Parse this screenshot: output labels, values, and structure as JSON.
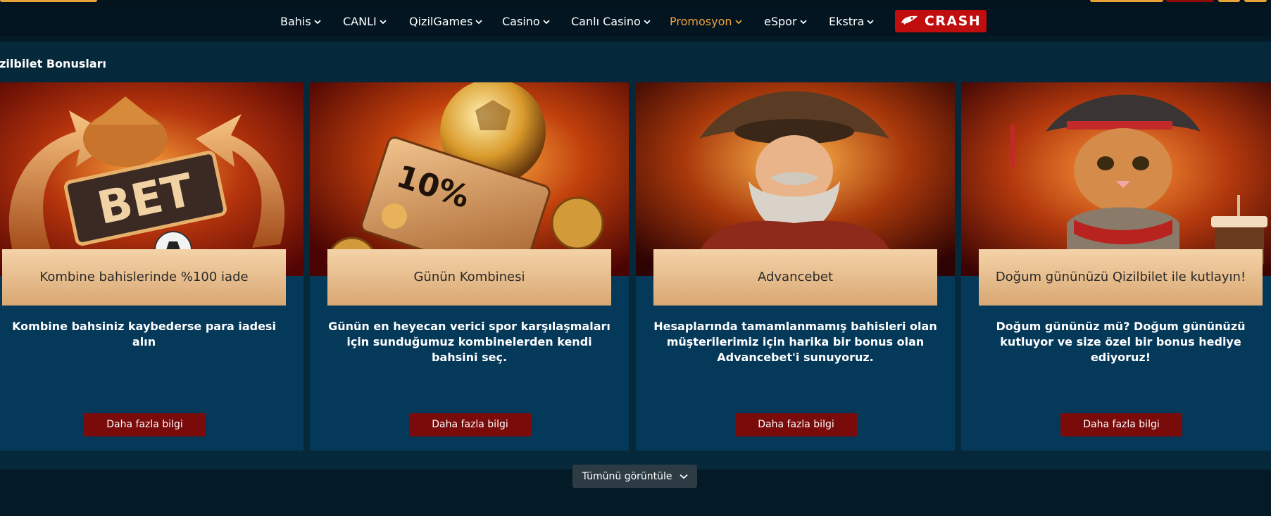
{
  "nav": {
    "items": [
      {
        "label": "Bahis"
      },
      {
        "label": "CANLI"
      },
      {
        "label": "QizilGames"
      },
      {
        "label": "Casino"
      },
      {
        "label": "Canlı Casino"
      },
      {
        "label": "Promosyon"
      },
      {
        "label": "eSpor"
      },
      {
        "label": "Ekstra"
      }
    ],
    "active": "Promosyon",
    "crash_label": "CRASH"
  },
  "section": {
    "title": "Qizilbilet Bonusları"
  },
  "cards": [
    {
      "title": "Kombine bahislerinde %100 iade",
      "description": "Kombine bahsiniz kaybederse para iadesi alın",
      "button": "Daha fazla bilgi",
      "art_text": "BET"
    },
    {
      "title": "Günün Kombinesi",
      "description": "Günün en heyecan verici spor karşılaşmaları için sunduğumuz kombinelerden kendi bahsini seç.",
      "button": "Daha fazla bilgi",
      "art_text": "10%"
    },
    {
      "title": "Advancebet",
      "description": "Hesaplarında tamamlanmamış bahisleri olan müşterilerimiz için harika bir bonus olan Advancebet'i sunuyoruz.",
      "button": "Daha fazla bilgi"
    },
    {
      "title": "Doğum gününüzü Qizilbilet ile kutlayın!",
      "description": "Doğum gününüz mü? Doğum gününüzü kutluyor ve size özel bir bonus hediye ediyoruz!",
      "button": "Daha fazla bilgi"
    }
  ],
  "view_all": {
    "label": "Tümünü görüntüle"
  },
  "colors": {
    "accent": "#f0a23a",
    "crash_red": "#c00d0d",
    "button_red": "#7a0b0b",
    "card_bg": "#05395a"
  }
}
